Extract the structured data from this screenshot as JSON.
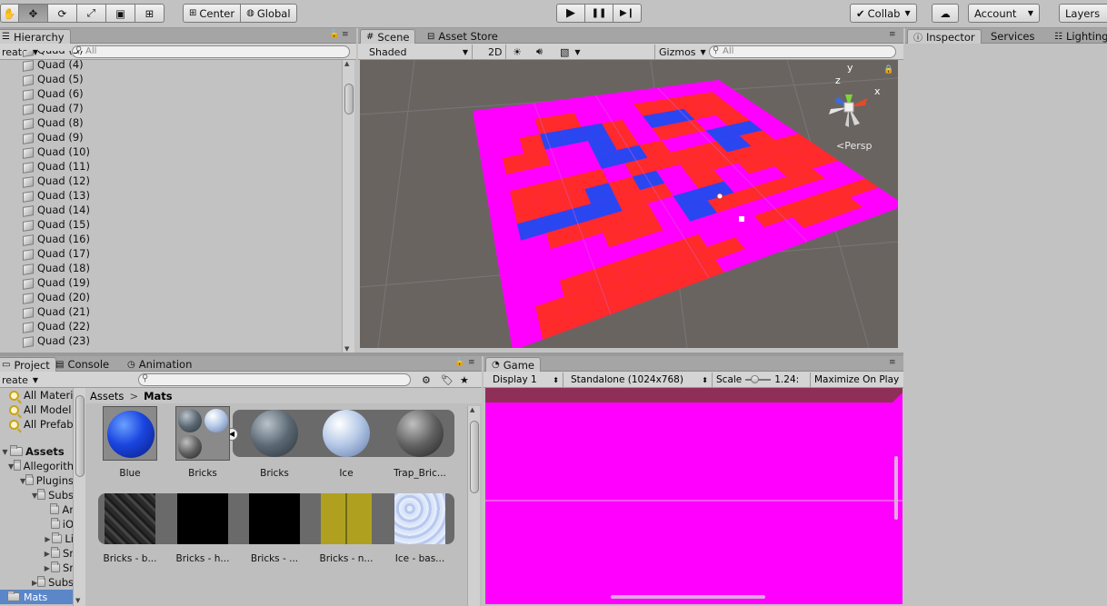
{
  "toolbar": {
    "tools": [
      {
        "name": "hand-tool",
        "glyph": "✋"
      },
      {
        "name": "move-tool",
        "glyph": "✥"
      },
      {
        "name": "rotate-tool",
        "glyph": "⟳"
      },
      {
        "name": "scale-tool",
        "glyph": "⤢"
      },
      {
        "name": "rect-tool",
        "glyph": "▣"
      },
      {
        "name": "transform-tool",
        "glyph": "⊞"
      }
    ],
    "pivot_label": "Center",
    "rotation_label": "Global",
    "play_glyph": "▶",
    "pause_glyph": "❚❚",
    "step_glyph": "▶❙",
    "collab_label": "Collab",
    "cloud_glyph": "☁",
    "account_label": "Account",
    "layers_label": "Layers"
  },
  "hierarchy": {
    "tab_label": "Hierarchy",
    "create_label": "reate",
    "search_placeholder": "All",
    "items": [
      "Quad (3)",
      "Quad (4)",
      "Quad (5)",
      "Quad (6)",
      "Quad (7)",
      "Quad (8)",
      "Quad (9)",
      "Quad (10)",
      "Quad (11)",
      "Quad (12)",
      "Quad (13)",
      "Quad (14)",
      "Quad (15)",
      "Quad (16)",
      "Quad (17)",
      "Quad (18)",
      "Quad (19)",
      "Quad (20)",
      "Quad (21)",
      "Quad (22)",
      "Quad (23)"
    ]
  },
  "scene": {
    "tab_label": "Scene",
    "asset_store_label": "Asset Store",
    "shading_label": "Shaded",
    "mode_2d_label": "2D",
    "gizmos_label": "Gizmos",
    "search_placeholder": "All",
    "persp_label": "Persp",
    "axis_x": "x",
    "axis_y": "y",
    "axis_z": "z",
    "colors": {
      "ground": "#ff00ff",
      "red": "#ff2a2a",
      "blue": "#2a46f0",
      "bg": "#6a6461"
    }
  },
  "inspector": {
    "tab_label": "Inspector",
    "services_label": "Services",
    "lighting_label": "Lighting"
  },
  "project": {
    "tab_label": "Project",
    "console_label": "Console",
    "animation_label": "Animation",
    "create_label": "reate",
    "favorites": [
      "All Materi",
      "All Model",
      "All Prefab"
    ],
    "tree": [
      {
        "label": "Assets",
        "bold": true,
        "indent": 0,
        "tri": "▼"
      },
      {
        "label": "Allegorith",
        "indent": 1,
        "tri": "▼"
      },
      {
        "label": "Plugins",
        "indent": 2,
        "tri": "▼"
      },
      {
        "label": "Subs",
        "indent": 3,
        "tri": "▼"
      },
      {
        "label": "Ar",
        "indent": 4,
        "tri": ""
      },
      {
        "label": "iO",
        "indent": 4,
        "tri": ""
      },
      {
        "label": "Li",
        "indent": 4,
        "tri": "▶"
      },
      {
        "label": "Sr",
        "indent": 4,
        "tri": "▶"
      },
      {
        "label": "Sr",
        "indent": 4,
        "tri": "▶"
      },
      {
        "label": "Subs",
        "indent": 3,
        "tri": "▶"
      }
    ],
    "selected_folder": "Mats",
    "breadcrumb_root": "Assets",
    "breadcrumb_current": "Mats",
    "row1": [
      "Blue",
      "Bricks",
      "Bricks",
      "Ice",
      "Trap_Bric..."
    ],
    "row2": [
      "Bricks - b...",
      "Bricks - h...",
      "Bricks - ...",
      "Bricks - n...",
      "Ice - bas..."
    ]
  },
  "game": {
    "tab_label": "Game",
    "display_label": "Display 1",
    "resolution_label": "Standalone (1024x768)",
    "scale_label": "Scale",
    "scale_value": "1.24:",
    "maximize_label": "Maximize On Play"
  }
}
